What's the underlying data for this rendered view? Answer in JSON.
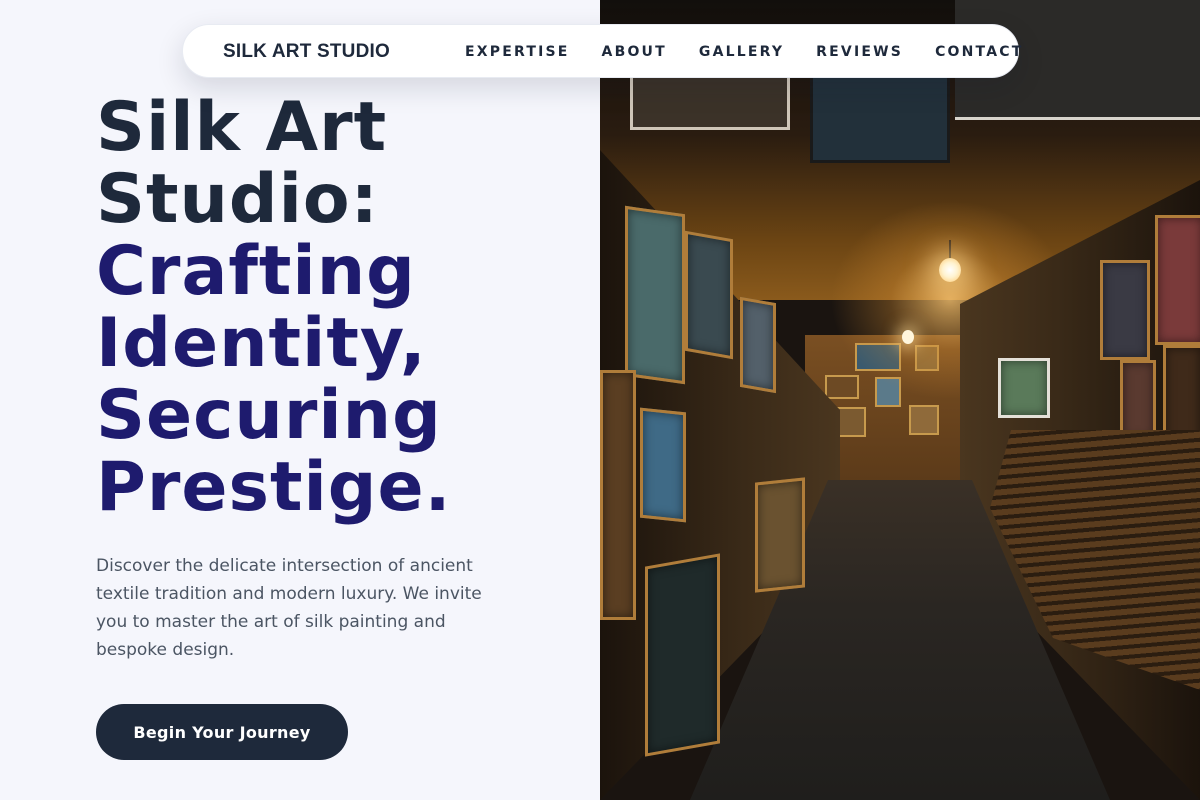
{
  "nav": {
    "brand": "SILK ART STUDIO",
    "links": [
      "EXPERTISE",
      "ABOUT",
      "GALLERY",
      "REVIEWS",
      "CONTACT"
    ]
  },
  "hero": {
    "title_lines_dark": [
      "Silk Art",
      "Studio:"
    ],
    "title_lines_accent": [
      "Crafting",
      "Identity,",
      "Securing",
      "Prestige."
    ],
    "description": "Discover the delicate intersection of ancient textile tradition and modern luxury. We invite you to master the art of silk painting and bespoke design.",
    "cta_label": "Begin Your Journey"
  },
  "colors": {
    "background": "#f5f6fc",
    "heading_dark": "#1e293b",
    "heading_accent": "#1e1b6e",
    "button_bg": "#1e293b",
    "body_text": "#4b5563"
  }
}
